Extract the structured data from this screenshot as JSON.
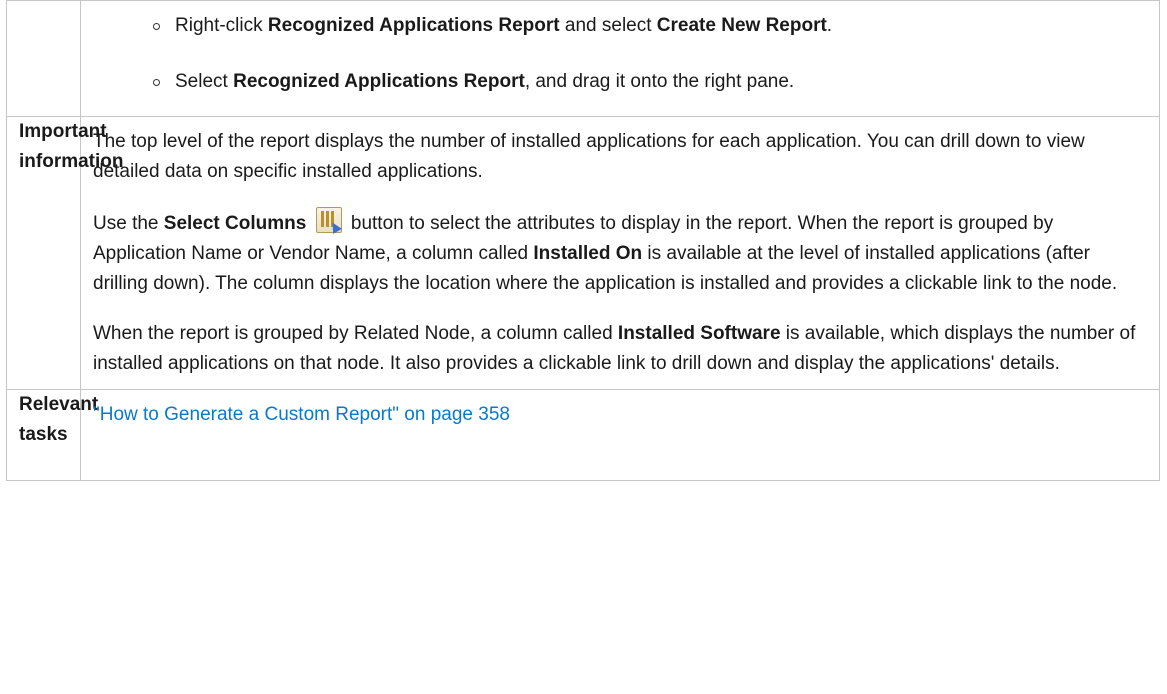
{
  "steps": {
    "step1": {
      "pre": "Right-click ",
      "bold1": "Recognized Applications Report",
      "mid": " and select ",
      "bold2": "Create New Report",
      "post": "."
    },
    "step2": {
      "pre": "Select ",
      "bold1": "Recognized Applications Report",
      "post": ", and drag it onto the right pane."
    }
  },
  "important": {
    "label_line1": "Important",
    "label_line2": "information",
    "p1": "The top level of the report displays the number of installed applications for each application. You can drill down to view detailed data on specific installed applications.",
    "p2": {
      "pre": "Use the ",
      "bold": "Select Columns",
      "icon": "select-columns-icon",
      "post": " button to select the attributes to display in the report. When the report is grouped by Application Name or Vendor Name, a column called ",
      "bold2": "Installed On",
      "post2": " is available at the level of installed applications (after drilling down). The column displays the location where the application is installed and provides a clickable link to the node."
    },
    "p3": {
      "pre": "When the report is grouped by Related Node, a column called ",
      "bold": "Installed Software",
      "post": " is available, which displays the number of installed applications on that node. It also provides a clickable link to drill down and display the applications' details."
    }
  },
  "relevant": {
    "label_line1": "Relevant",
    "label_line2": "tasks",
    "link": "\"How to Generate a Custom Report\" on page 358"
  },
  "colors": {
    "link": "#0a7ac7",
    "border": "#c6c6c6"
  }
}
